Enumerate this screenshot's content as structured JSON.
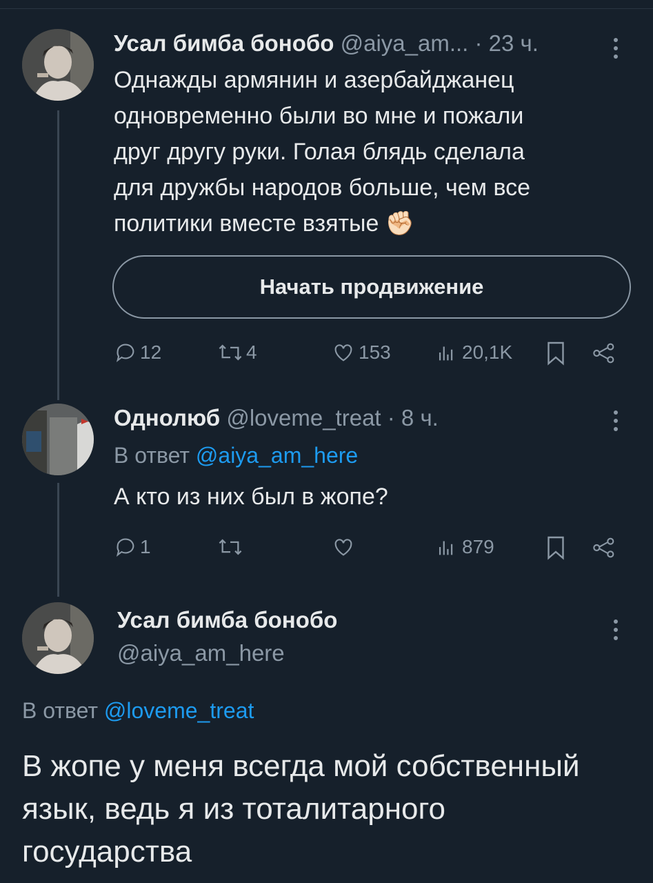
{
  "tweets": [
    {
      "author_name": "Усал бимба бонобо",
      "handle": "@aiya_am...",
      "time": "· 23 ч.",
      "lines": [
        "Однажды армянин и азербайджанец",
        "одновременно были во мне и пожали",
        "друг другу руки. Голая блядь сделала",
        "для дружбы народов больше, чем все",
        "политики вместе взятые"
      ],
      "emoji": "✊🏻",
      "promote_label": "Начать продвижение",
      "replies": "12",
      "retweets": "4",
      "likes": "153",
      "views": "20,1K"
    },
    {
      "author_name": "Однолюб",
      "handle": "@loveme_treat",
      "time": "· 8 ч.",
      "reply_prefix": "В ответ",
      "reply_handle": "@aiya_am_here",
      "text": "А кто из них был в жопе?",
      "replies": "1",
      "retweets": "",
      "likes": "",
      "views": "879"
    },
    {
      "author_name": "Усал бимба бонобо",
      "handle": "@aiya_am_here",
      "reply_prefix": "В ответ",
      "reply_handle": "@loveme_treat",
      "lines": [
        "В жопе у меня всегда мой собственный",
        "язык, ведь я из тоталитарного",
        "государства"
      ]
    }
  ],
  "icons": {
    "reply": "reply-icon",
    "retweet": "retweet-icon",
    "like": "heart-icon",
    "views": "views-icon",
    "bookmark": "bookmark-icon",
    "share": "share-icon",
    "more": "more-vertical-icon"
  },
  "colors": {
    "background": "#16202b",
    "text": "#e7e9ea",
    "muted": "#8b98a5",
    "link": "#1d9bf0"
  }
}
